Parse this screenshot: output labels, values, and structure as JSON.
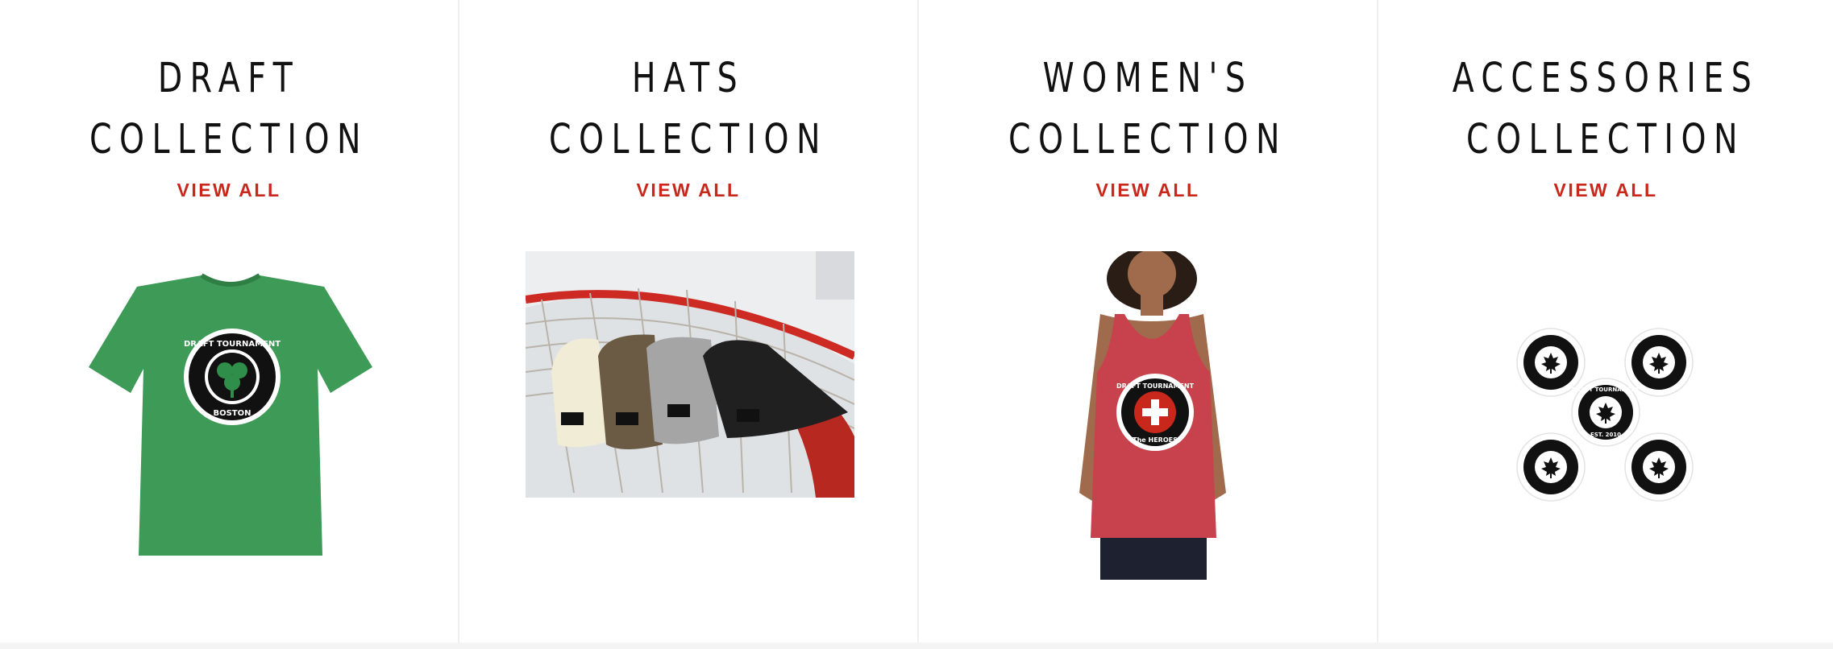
{
  "collections": [
    {
      "title_line1": "DRAFT",
      "title_line2": "COLLECTION",
      "link": "VIEW ALL",
      "image_text_top": "DRAFT TOURNAMENT",
      "image_text_bottom": "BOSTON"
    },
    {
      "title_line1": "HATS",
      "title_line2": "COLLECTION",
      "link": "VIEW ALL"
    },
    {
      "title_line1": "WOMEN'S",
      "title_line2": "COLLECTION",
      "link": "VIEW ALL",
      "image_text_top": "DRAFT TOURNAMENT",
      "image_text_bottom": "The HEROES"
    },
    {
      "title_line1": "ACCESSORIES",
      "title_line2": "COLLECTION",
      "link": "VIEW ALL",
      "image_text_top": "DRAFT TOURNAMENT",
      "image_text_bottom": "EST. 2010"
    }
  ],
  "colors": {
    "accent": "#c8271c",
    "title": "#111111",
    "tee_green": "#3d9a57",
    "tank_red": "#c7424c"
  }
}
